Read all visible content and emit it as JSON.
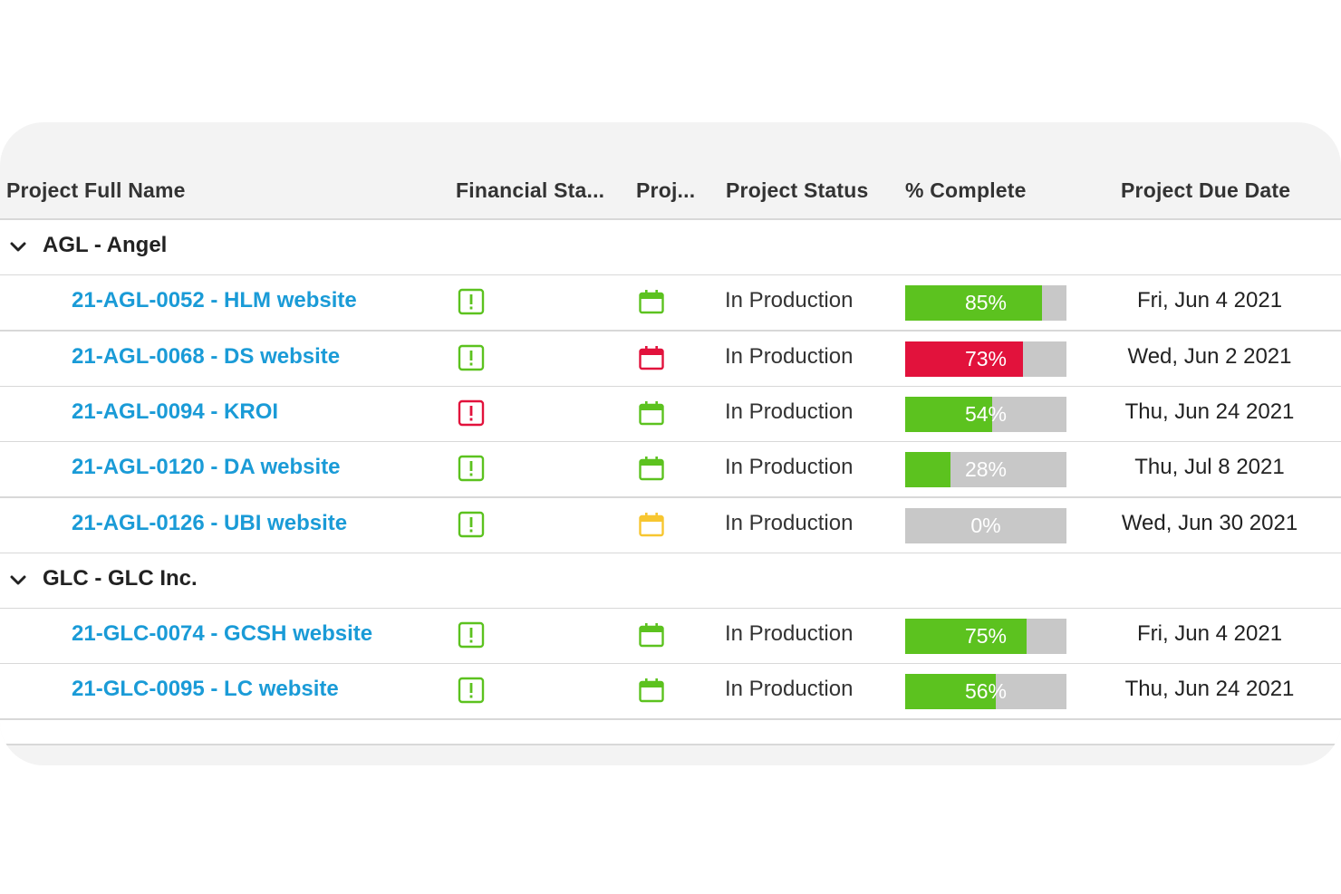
{
  "columns": {
    "name": "Project Full Name",
    "financial": "Financial Sta...",
    "proj": "Proj...",
    "status": "Project Status",
    "complete": "% Complete",
    "due": "Project Due Date"
  },
  "colors": {
    "link": "#1a9bd7",
    "green": "#5cc21f",
    "red": "#e2123c",
    "yellow": "#f7c630",
    "bar_bg": "#c8c8c8"
  },
  "groups": [
    {
      "label": "AGL - Angel",
      "rows": [
        {
          "name": "21-AGL-0052 - HLM website",
          "financial_icon": "alert-icon",
          "financial_color": "green",
          "schedule_icon": "calendar-icon",
          "schedule_color": "green",
          "status": "In Production",
          "percent": 85,
          "percent_label": "85%",
          "bar_color": "green",
          "due": "Fri, Jun 4 2021"
        },
        {
          "name": "21-AGL-0068 - DS website",
          "financial_icon": "alert-icon",
          "financial_color": "green",
          "schedule_icon": "calendar-icon",
          "schedule_color": "red",
          "status": "In Production",
          "percent": 73,
          "percent_label": "73%",
          "bar_color": "red",
          "due": "Wed, Jun 2 2021"
        },
        {
          "name": "21-AGL-0094 - KROI",
          "financial_icon": "alert-icon",
          "financial_color": "red",
          "schedule_icon": "calendar-icon",
          "schedule_color": "green",
          "status": "In Production",
          "percent": 54,
          "percent_label": "54%",
          "bar_color": "green",
          "due": "Thu, Jun 24 2021"
        },
        {
          "name": "21-AGL-0120 - DA website",
          "financial_icon": "alert-icon",
          "financial_color": "green",
          "schedule_icon": "calendar-icon",
          "schedule_color": "green",
          "status": "In Production",
          "percent": 28,
          "percent_label": "28%",
          "bar_color": "green",
          "due": "Thu, Jul 8 2021"
        },
        {
          "name": "21-AGL-0126 - UBI website",
          "financial_icon": "alert-icon",
          "financial_color": "green",
          "schedule_icon": "calendar-icon",
          "schedule_color": "yellow",
          "status": "In Production",
          "percent": 0,
          "percent_label": "0%",
          "bar_color": "green",
          "due": "Wed, Jun 30 2021"
        }
      ]
    },
    {
      "label": "GLC - GLC Inc.",
      "rows": [
        {
          "name": "21-GLC-0074 - GCSH website",
          "financial_icon": "alert-icon",
          "financial_color": "green",
          "schedule_icon": "calendar-icon",
          "schedule_color": "green",
          "status": "In Production",
          "percent": 75,
          "percent_label": "75%",
          "bar_color": "green",
          "due": "Fri, Jun 4 2021"
        },
        {
          "name": "21-GLC-0095 - LC website",
          "financial_icon": "alert-icon",
          "financial_color": "green",
          "schedule_icon": "calendar-icon",
          "schedule_color": "green",
          "status": "In Production",
          "percent": 56,
          "percent_label": "56%",
          "bar_color": "green",
          "due": "Thu, Jun 24 2021"
        }
      ]
    }
  ]
}
